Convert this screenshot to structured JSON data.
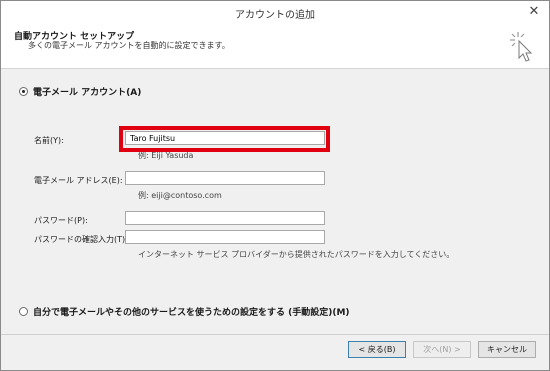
{
  "window": {
    "title": "アカウントの追加",
    "close_glyph": "✕"
  },
  "header": {
    "title": "自動アカウント セットアップ",
    "subtitle": "多くの電子メール アカウントを自動的に設定できます。",
    "icon": "wizard-cursor-icon"
  },
  "email_option": {
    "label": "電子メール アカウント(A)",
    "selected": true
  },
  "form": {
    "name": {
      "label": "名前(Y):",
      "value": "Taro Fujitsu",
      "hint": "例: Eiji Yasuda"
    },
    "email": {
      "label": "電子メール アドレス(E):",
      "value": "",
      "hint": "例: eiji@contoso.com"
    },
    "password": {
      "label": "パスワード(P):",
      "value": ""
    },
    "password_confirm": {
      "label": "パスワードの確認入力(T):",
      "value": "",
      "hint": "インターネット サービス プロバイダーから提供されたパスワードを入力してください。"
    }
  },
  "manual_option": {
    "label": "自分で電子メールやその他のサービスを使うための設定をする (手動設定)(M)",
    "selected": false
  },
  "buttons": {
    "back": "< 戻る(B)",
    "next": "次へ(N) >",
    "cancel": "キャンセル"
  },
  "colors": {
    "highlight": "#e0000f"
  }
}
